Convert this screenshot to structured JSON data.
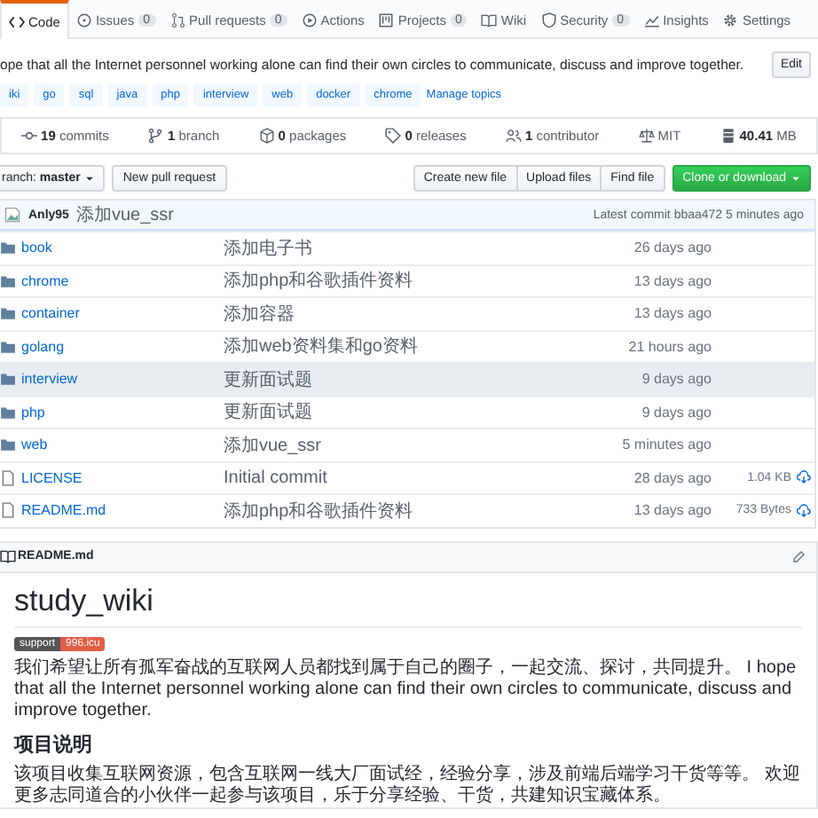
{
  "tabs": [
    {
      "label": "Code",
      "selected": true
    },
    {
      "label": "Issues",
      "count": "0",
      "selected": false
    },
    {
      "label": "Pull requests",
      "count": "0",
      "selected": false
    },
    {
      "label": "Actions",
      "selected": false
    },
    {
      "label": "Projects",
      "count": "0",
      "selected": false
    },
    {
      "label": "Wiki",
      "selected": false
    },
    {
      "label": "Security",
      "count": "0",
      "selected": false
    },
    {
      "label": "Insights",
      "selected": false
    },
    {
      "label": "Settings",
      "selected": false
    }
  ],
  "description": "ope that all the Internet personnel working alone can find their own circles to communicate, discuss and improve together.",
  "edit_button": "Edit",
  "topics": [
    "iki",
    "go",
    "sql",
    "java",
    "php",
    "interview",
    "web",
    "docker",
    "chrome"
  ],
  "manage_topics": "Manage topics",
  "stats": [
    "**19** commits",
    "**1** branch",
    "**0** packages",
    "**0** releases",
    "**1** contributor",
    "MIT",
    "**40.41** MB"
  ],
  "branch_button": "ranch: **master**",
  "new_pull_request": "New pull request",
  "file_buttons": [
    "Create new file",
    "Upload files",
    "Find file"
  ],
  "clone_button": "Clone or download",
  "latest_commit": {
    "author": "Anly95",
    "message": "添加vue_ssr",
    "info": "Latest commit bbaa472 5 minutes ago"
  },
  "files": [
    {
      "kind": "folder",
      "name": "book",
      "message": "添加电子书",
      "age": "26 days ago",
      "hovered": false
    },
    {
      "kind": "folder",
      "name": "chrome",
      "message": "添加php和谷歌插件资料",
      "age": "13 days ago",
      "hovered": false
    },
    {
      "kind": "folder",
      "name": "container",
      "message": "添加容器",
      "age": "13 days ago",
      "hovered": false
    },
    {
      "kind": "folder",
      "name": "golang",
      "message": "添加web资料集和go资料",
      "age": "21 hours ago",
      "hovered": false
    },
    {
      "kind": "folder",
      "name": "interview",
      "message": "更新面试题",
      "age": "9 days ago",
      "hovered": true
    },
    {
      "kind": "folder",
      "name": "php",
      "message": "更新面试题",
      "age": "9 days ago",
      "hovered": false
    },
    {
      "kind": "folder",
      "name": "web",
      "message": "添加vue_ssr",
      "age": "5 minutes ago",
      "hovered": false
    },
    {
      "kind": "file",
      "name": "LICENSE",
      "message": "Initial commit",
      "age": "28 days ago",
      "size": "1.04 KB",
      "hovered": false
    },
    {
      "kind": "file",
      "name": "README.md",
      "message": "添加php和谷歌插件资料",
      "age": "13 days ago",
      "size": "733 Bytes",
      "hovered": false
    }
  ],
  "readme": {
    "filename": "README.md",
    "title": "study_wiki",
    "badge": {
      "label": "support",
      "value": "996.icu"
    },
    "intro": "我们希望让所有孤军奋战的互联网人员都找到属于自己的圈子，一起交流、探讨，共同提升。 I hope that all the Internet personnel working alone can find their own circles to communicate, discuss and improve together.",
    "section_title": "项目说明",
    "section_text": "该项目收集互联网资源，包含互联网一线大厂面试经，经验分享，涉及前端后端学习干货等等。 欢迎更多志同道合的小伙伴一起参与该项目，乐于分享经验、干货，共建知识宝藏体系。"
  }
}
